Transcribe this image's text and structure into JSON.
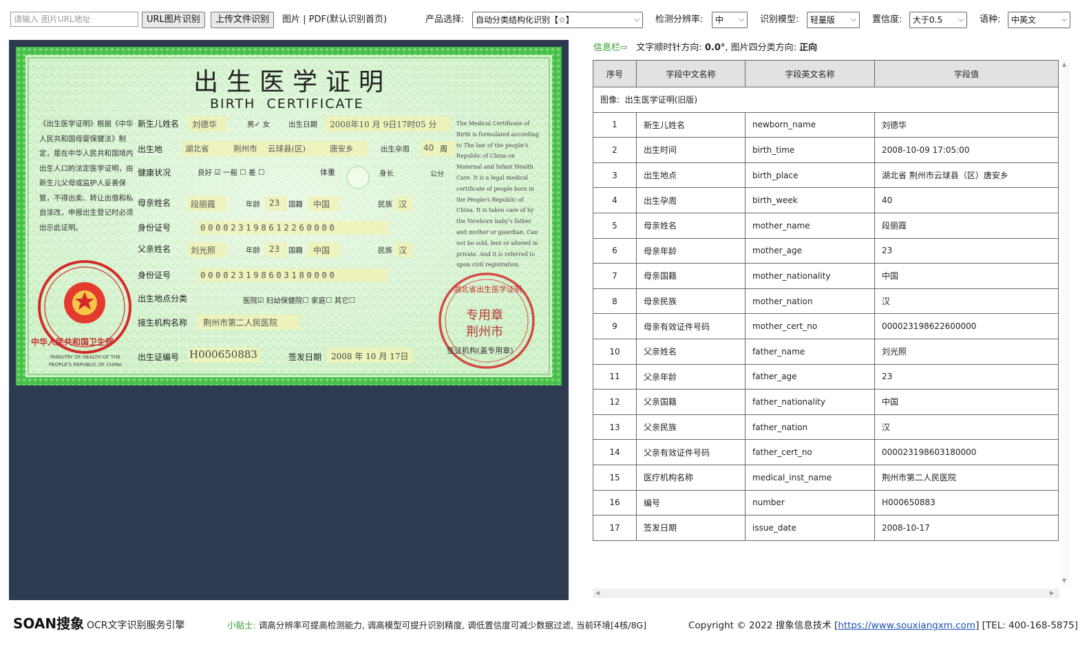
{
  "toolbar": {
    "url_placeholder": "请输入 图片URL地址",
    "url_button": "URL图片识别",
    "upload_button": "上传文件识别",
    "file_types": "图片 | PDF(默认识别首页)",
    "product_label": "产品选择:",
    "product_value": "自动分类结构化识别【☆】",
    "resolution_label": "检测分辨率:",
    "resolution_value": "中",
    "model_label": "识别模型:",
    "model_value": "轻量版",
    "confidence_label": "置信度:",
    "confidence_value": "大于0.5",
    "language_label": "语种:",
    "language_value": "中英文"
  },
  "certificate": {
    "title_cn": "出生医学证明",
    "title_en": "BIRTH  CERTIFICATE",
    "intro_cn": "《出生医学证明》根据《中华人民共和国母婴保健法》制定，是在中华人民共和国境内出生人口的法定医学证明，由新生儿父母或监护人妥善保管，不得出卖、转让出借和私自涂改，申报出生登记时必须出示此证明。",
    "intro_en": "The Medical Certificate of Birth is formulated according to The law of the people's Republic of China on Maternal and Infant Health Care. It is a legal medical certificate of people born in the People's Republic of China. It is taken care of by the Newborn baby's father and mother or guardian. Can not be sold, lent or altered in private. And it is referred to upon civil registration.",
    "newborn_label": "新生儿姓名",
    "newborn_name": "刘德华",
    "gender_text": "男✓ 女",
    "birth_date_label": "出生日期",
    "birth_date": "2008年10 月 9日17时05 分",
    "birth_place_label": "出生地",
    "province": "湖北省",
    "city": "荆州市",
    "county": "云球县(区)",
    "township": "唐安乡",
    "gestation_label": "出生孕周",
    "gestation": "40",
    "gestation_unit": "周",
    "health_label": "健康状况",
    "health_text": "良好 ☑  一般 ☐  差 ☐",
    "weight_label": "体重",
    "height_label": "身长",
    "height_unit": "公分",
    "mother_label": "母亲姓名",
    "mother_name": "段丽霞",
    "age_label": "年龄",
    "mother_age": "23",
    "nationality_label": "国籍",
    "mother_nationality": "中国",
    "ethnic_label": "民族",
    "mother_ethnic": "汉",
    "id_label": "身份证号",
    "mother_id": "000023198612260000",
    "father_label": "父亲姓名",
    "father_name": "刘光照",
    "father_age": "23",
    "father_nationality": "中国",
    "father_ethnic": "汉",
    "father_id": "000023198603180000",
    "place_type_label": "出生地点分类",
    "place_type_text": "医院☑  妇幼保健院☐  家庭☐  其它☐",
    "facility_label": "接生机构名称",
    "facility": "荆州市第二人民医院",
    "cert_no_label": "出生证编号",
    "cert_no": "H000650883",
    "issue_label": "签发日期",
    "issue_date": "2008 年 10 月 17日",
    "issuer_label": "签证机构(盖专用章)",
    "seal_left_text": "中华人民共和国卫生部",
    "seal_left_en": "MINISTRY OF HEALTH OF THE PEOPLE'S REPUBLIC OF CHINA",
    "seal_right_outer": "湖北省出生医学证明",
    "seal_right_inner1": "专用章",
    "seal_right_inner2": "荆州市"
  },
  "info_bar": {
    "label": "信息栏⇨",
    "rotation_text": "文字顺时针方向:",
    "rotation_value": "0.0°",
    "orientation_text": ", 图片四分类方向:",
    "orientation_value": "正向"
  },
  "table": {
    "headers": [
      "序号",
      "字段中文名称",
      "字段英文名称",
      "字段值"
    ],
    "image_label": "图像:",
    "image_type": "出生医学证明(旧版)",
    "rows": [
      {
        "idx": "1",
        "cn": "新生儿姓名",
        "en": "newborn_name",
        "value": "刘德华"
      },
      {
        "idx": "2",
        "cn": "出生时间",
        "en": "birth_time",
        "value": "2008-10-09 17:05:00"
      },
      {
        "idx": "3",
        "cn": "出生地点",
        "en": "birth_place",
        "value": "湖北省 荆州市云球县（区）唐安乡"
      },
      {
        "idx": "4",
        "cn": "出生孕周",
        "en": "birth_week",
        "value": "40"
      },
      {
        "idx": "5",
        "cn": "母亲姓名",
        "en": "mother_name",
        "value": "段丽霞"
      },
      {
        "idx": "6",
        "cn": "母亲年龄",
        "en": "mother_age",
        "value": "23"
      },
      {
        "idx": "7",
        "cn": "母亲国籍",
        "en": "mother_nationality",
        "value": "中国"
      },
      {
        "idx": "8",
        "cn": "母亲民族",
        "en": "mother_nation",
        "value": "汉"
      },
      {
        "idx": "9",
        "cn": "母亲有效证件号码",
        "en": "mother_cert_no",
        "value": "000023198622600000"
      },
      {
        "idx": "10",
        "cn": "父亲姓名",
        "en": "father_name",
        "value": "刘光照"
      },
      {
        "idx": "11",
        "cn": "父亲年龄",
        "en": "father_age",
        "value": "23"
      },
      {
        "idx": "12",
        "cn": "父亲国籍",
        "en": "father_nationality",
        "value": "中国"
      },
      {
        "idx": "13",
        "cn": "父亲民族",
        "en": "father_nation",
        "value": "汉"
      },
      {
        "idx": "14",
        "cn": "父亲有效证件号码",
        "en": "father_cert_no",
        "value": "000023198603180000"
      },
      {
        "idx": "15",
        "cn": "医疗机构名称",
        "en": "medical_inst_name",
        "value": "荆州市第二人民医院"
      },
      {
        "idx": "16",
        "cn": "编号",
        "en": "number",
        "value": "H000650883"
      },
      {
        "idx": "17",
        "cn": "签发日期",
        "en": "issue_date",
        "value": "2008-10-17"
      }
    ]
  },
  "footer": {
    "logo_a": "SOAN",
    "logo_b": "搜象",
    "engine": "OCR文字识别服务引擎",
    "tip_label": "小贴士:",
    "tip_text": "调高分辨率可提高检测能力, 调高模型可提升识别精度, 调低置信度可减少数据过滤, 当前环境[4核/8G]",
    "copyright_prefix": "Copyright © 2022 搜象信息技术 [",
    "copyright_link": "https://www.souxiangxm.com",
    "copyright_suffix": "] [TEL: 400-168-5875]"
  },
  "colors": {
    "panel_bg": "#2e3a4f",
    "cert_green": "#c8eec3",
    "seal_red": "#d42a2a",
    "info_green": "#2a9a2a",
    "link_blue": "#1a4fb5",
    "header_gray": "#e2e2e2"
  }
}
